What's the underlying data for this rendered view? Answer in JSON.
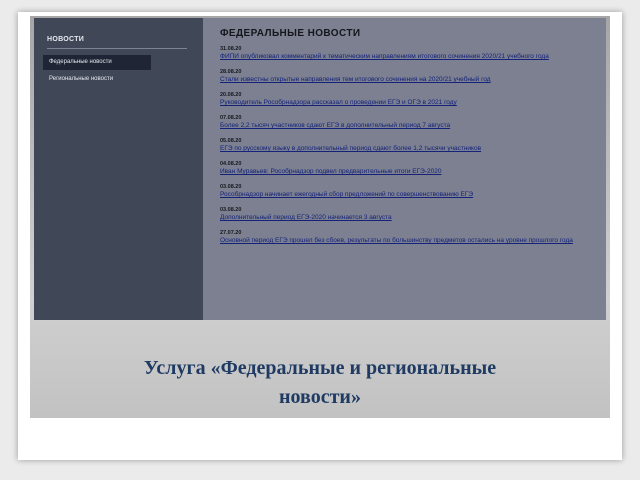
{
  "sidebar": {
    "title": "НОВОСТИ",
    "items": [
      {
        "label": "Федеральные новости",
        "active": true
      },
      {
        "label": "Региональные новости",
        "active": false
      }
    ]
  },
  "content": {
    "title": "ФЕДЕРАЛЬНЫЕ НОВОСТИ",
    "news": [
      {
        "date": "31.08.20",
        "title": "ФИПИ опубликовал комментарий к тематическим направлениям итогового сочинения 2020/21 учебного года"
      },
      {
        "date": "28.08.20",
        "title": "Стали известны открытые направления тем итогового сочинения на 2020/21 учебный год"
      },
      {
        "date": "20.08.20",
        "title": "Руководитель Рособрнадзора рассказал о проведении ЕГЭ и ОГЭ в 2021 году"
      },
      {
        "date": "07.08.20",
        "title": "Более 2,2 тысяч участников сдают ЕГЭ в дополнительный период 7 августа"
      },
      {
        "date": "05.08.20",
        "title": "ЕГЭ по русскому языку в дополнительный период сдают более 1,2 тысячи участников"
      },
      {
        "date": "04.08.20",
        "title": "Иван Муравьев: Рособрнадзор подвел предварительные итоги ЕГЭ-2020"
      },
      {
        "date": "03.08.20",
        "title": "Рособрнадзор начинает ежегодный сбор предложений по совершенствованию ЕГЭ"
      },
      {
        "date": "03.08.20",
        "title": "Дополнительный период ЕГЭ-2020 начинается 3 августа"
      },
      {
        "date": "27.07.20",
        "title": "Основной период ЕГЭ прошел без сбоев, результаты по большинству предметов остались на уровне прошлого года"
      }
    ]
  },
  "caption": {
    "line1": "Услуга «Федеральные и региональные",
    "line2": "новости»"
  }
}
